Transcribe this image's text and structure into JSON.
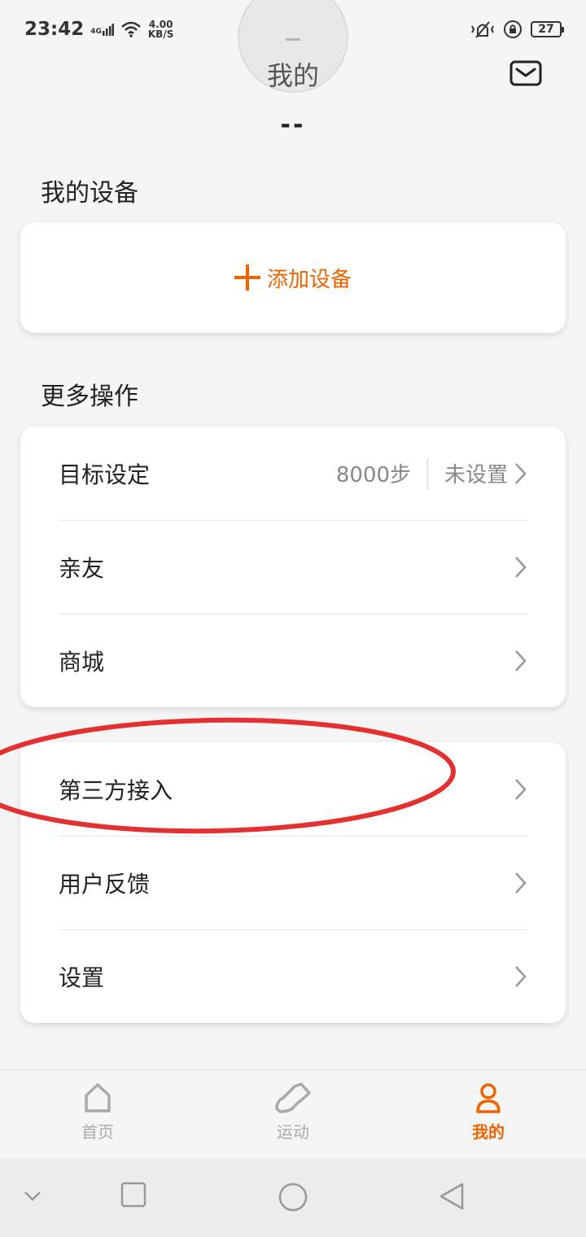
{
  "status_bar": {
    "time": "23:42",
    "network": "4G",
    "speed_value": "4.00",
    "speed_unit": "KB/S",
    "battery": "27"
  },
  "header": {
    "avatar_placeholder": "–",
    "title": "我的",
    "user_name": "--"
  },
  "devices": {
    "section_title": "我的设备",
    "add_label": "添加设备"
  },
  "more": {
    "section_title": "更多操作",
    "goal_label": "目标设定",
    "goal_steps": "8000步",
    "goal_status": "未设置",
    "friends_label": "亲友",
    "mall_label": "商城"
  },
  "others": {
    "third_party_label": "第三方接入",
    "feedback_label": "用户反馈",
    "settings_label": "设置"
  },
  "tabs": {
    "home": "首页",
    "sport": "运动",
    "mine": "我的"
  },
  "colors": {
    "accent": "#f06400",
    "annotation": "#e53030"
  }
}
